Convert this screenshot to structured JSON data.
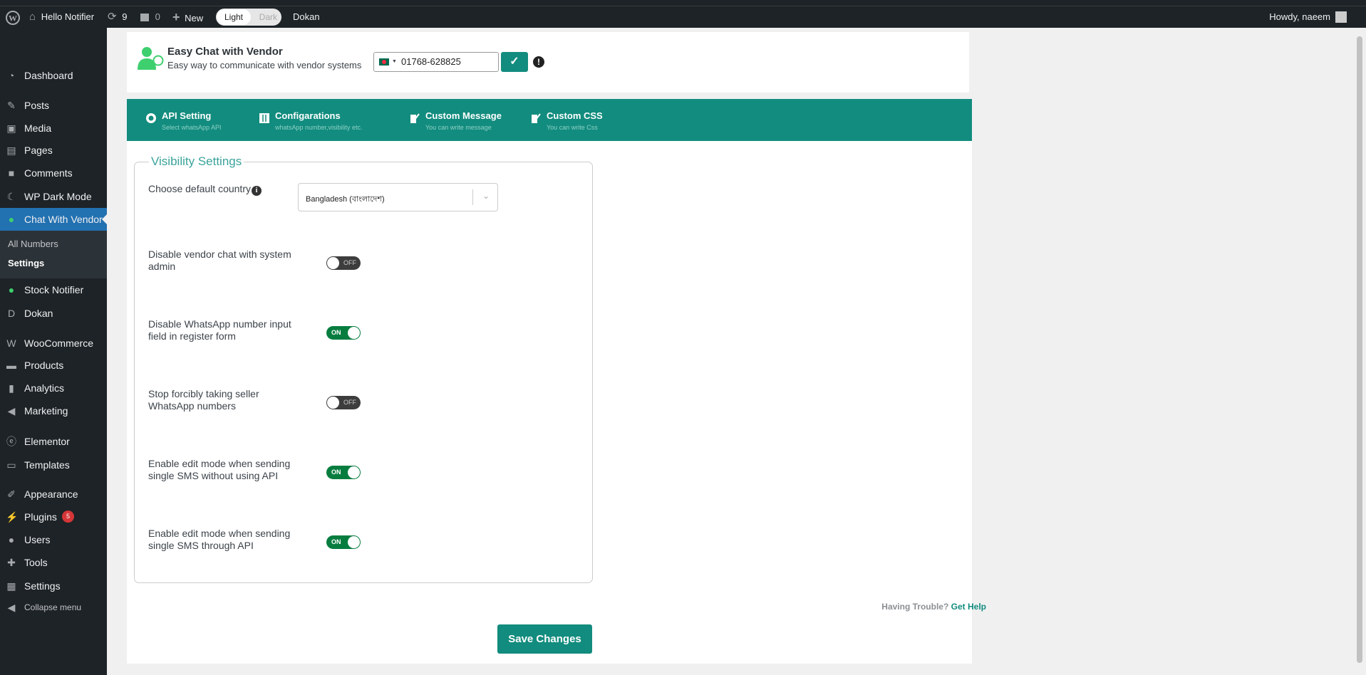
{
  "admin_bar": {
    "site_name": "Hello Notifier",
    "updates_count": "9",
    "comments_count": "0",
    "new_label": "New",
    "mode_light": "Light",
    "mode_dark": "Dark",
    "dokan_label": "Dokan",
    "howdy": "Howdy, naeem"
  },
  "sidebar": {
    "items": [
      {
        "label": "Dashboard",
        "icon": "dashboard-icon"
      },
      {
        "label": "Posts",
        "icon": "pin-icon"
      },
      {
        "label": "Media",
        "icon": "media-icon"
      },
      {
        "label": "Pages",
        "icon": "pages-icon"
      },
      {
        "label": "Comments",
        "icon": "comment-icon"
      },
      {
        "label": "WP Dark Mode",
        "icon": "moon-icon"
      },
      {
        "label": "Chat With Vendor",
        "icon": "chat-vendor-icon",
        "active": true
      },
      {
        "label": "Stock Notifier",
        "icon": "stock-notifier-icon"
      },
      {
        "label": "Dokan",
        "icon": "dokan-icon"
      },
      {
        "label": "WooCommerce",
        "icon": "woo-icon"
      },
      {
        "label": "Products",
        "icon": "archive-icon"
      },
      {
        "label": "Analytics",
        "icon": "chart-icon"
      },
      {
        "label": "Marketing",
        "icon": "megaphone-icon"
      },
      {
        "label": "Elementor",
        "icon": "elementor-icon"
      },
      {
        "label": "Templates",
        "icon": "folder-icon"
      },
      {
        "label": "Appearance",
        "icon": "brush-icon"
      },
      {
        "label": "Plugins",
        "icon": "plugin-icon",
        "badge": "5"
      },
      {
        "label": "Users",
        "icon": "user-icon"
      },
      {
        "label": "Tools",
        "icon": "wrench-icon"
      },
      {
        "label": "Settings",
        "icon": "settings-icon"
      },
      {
        "label": "Collapse menu",
        "icon": "collapse-icon"
      }
    ],
    "submenu": [
      "All Numbers",
      "Settings"
    ]
  },
  "header": {
    "title": "Easy Chat with Vendor",
    "subtitle": "Easy way to communicate with vendor systems",
    "phone_value": "01768-628825"
  },
  "tabs": [
    {
      "title": "API Setting",
      "sub": "Select whatsApp API"
    },
    {
      "title": "Configarations",
      "sub": "whatsApp number,visibility etc."
    },
    {
      "title": "Custom Message",
      "sub": "You can write message"
    },
    {
      "title": "Custom CSS",
      "sub": "You can write Css"
    }
  ],
  "visibility": {
    "legend": "Visibility Settings",
    "country_label": "Choose default country",
    "country_value": "Bangladesh (বাংলাদেশ)",
    "settings": [
      {
        "label": "Disable vendor chat with system admin",
        "state": "OFF"
      },
      {
        "label": "Disable WhatsApp number input field in register form",
        "state": "ON"
      },
      {
        "label": "Stop forcibly taking seller WhatsApp numbers",
        "state": "OFF"
      },
      {
        "label": "Enable edit mode when sending single SMS without using API",
        "state": "ON"
      },
      {
        "label": "Enable edit mode when sending single SMS through API",
        "state": "ON"
      }
    ]
  },
  "footer": {
    "trouble": "Having Trouble?",
    "get_help": "Get Help",
    "save_label": "Save Changes"
  },
  "colors": {
    "brand": "#128c7e",
    "toggle_on": "#067d3f",
    "wp_active": "#2271b1"
  }
}
